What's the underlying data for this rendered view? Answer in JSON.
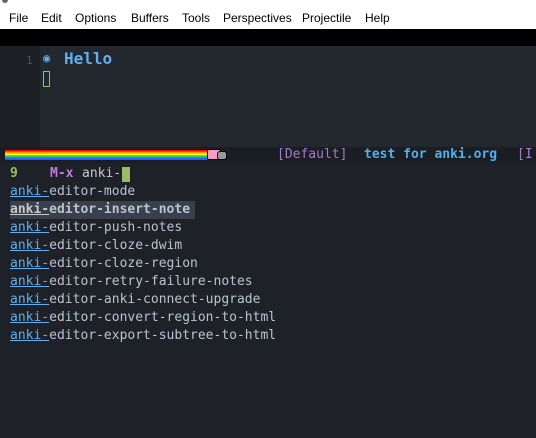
{
  "menubar": {
    "items": [
      "File",
      "Edit",
      "Options",
      "Buffers",
      "Tools",
      "Perspectives",
      "Projectile",
      "Help"
    ]
  },
  "editor": {
    "line_number": "1",
    "bullet": "◉",
    "heading": "Hello"
  },
  "modeline": {
    "perspective": "[Default]",
    "buffer_name": "test for anki.org",
    "truncated": "[I"
  },
  "minibuffer": {
    "candidate_count": "9",
    "prompt": "M-x",
    "query": "anki-",
    "candidates": [
      {
        "match": "anki-",
        "rest": "editor-mode"
      },
      {
        "match": "anki-",
        "rest": "editor-insert-note"
      },
      {
        "match": "anki-",
        "rest": "editor-push-notes"
      },
      {
        "match": "anki-",
        "rest": "editor-cloze-dwim"
      },
      {
        "match": "anki-",
        "rest": "editor-cloze-region"
      },
      {
        "match": "anki-",
        "rest": "editor-retry-failure-notes"
      },
      {
        "match": "anki-",
        "rest": "editor-anki-connect-upgrade"
      },
      {
        "match": "anki-",
        "rest": "editor-convert-region-to-html"
      },
      {
        "match": "anki-",
        "rest": "editor-export-subtree-to-html"
      }
    ],
    "selected_index": 1
  }
}
